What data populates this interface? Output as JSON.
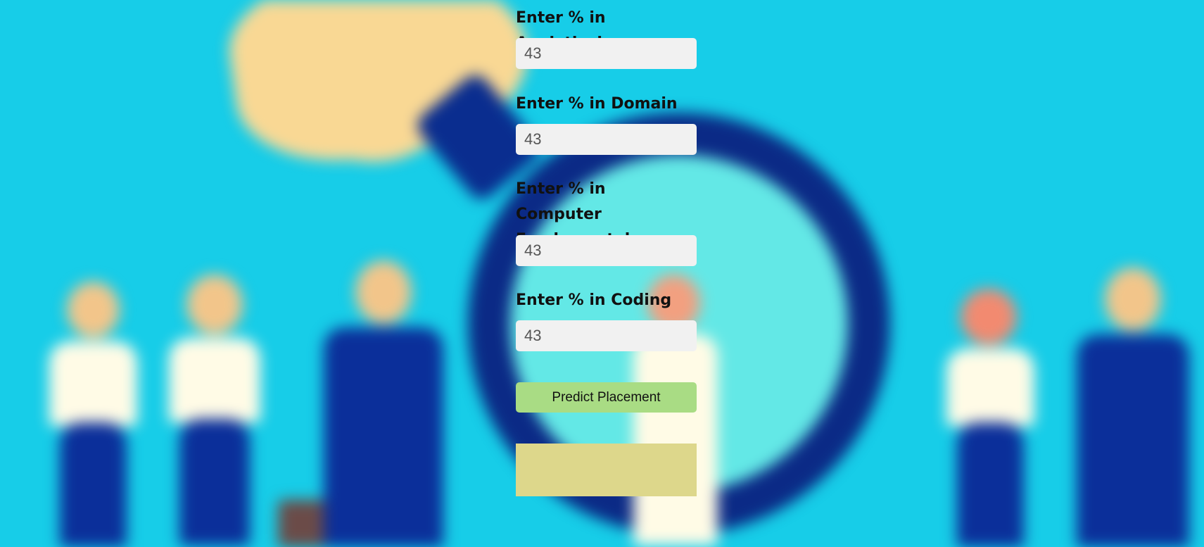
{
  "form": {
    "fields": [
      {
        "label": "Enter % in Analytical",
        "value": "43"
      },
      {
        "label": "Enter % in Domain",
        "value": "43"
      },
      {
        "label": "Enter % in Computer Fundamentals",
        "value": "43"
      },
      {
        "label": "Enter % in Coding",
        "value": "43"
      }
    ],
    "submit_label": "Predict Placement",
    "result_text": ""
  },
  "colors": {
    "background": "#17cde8",
    "input_bg": "#f1f1f1",
    "button_bg": "#a9dc84",
    "result_bg": "#ddd78b"
  }
}
